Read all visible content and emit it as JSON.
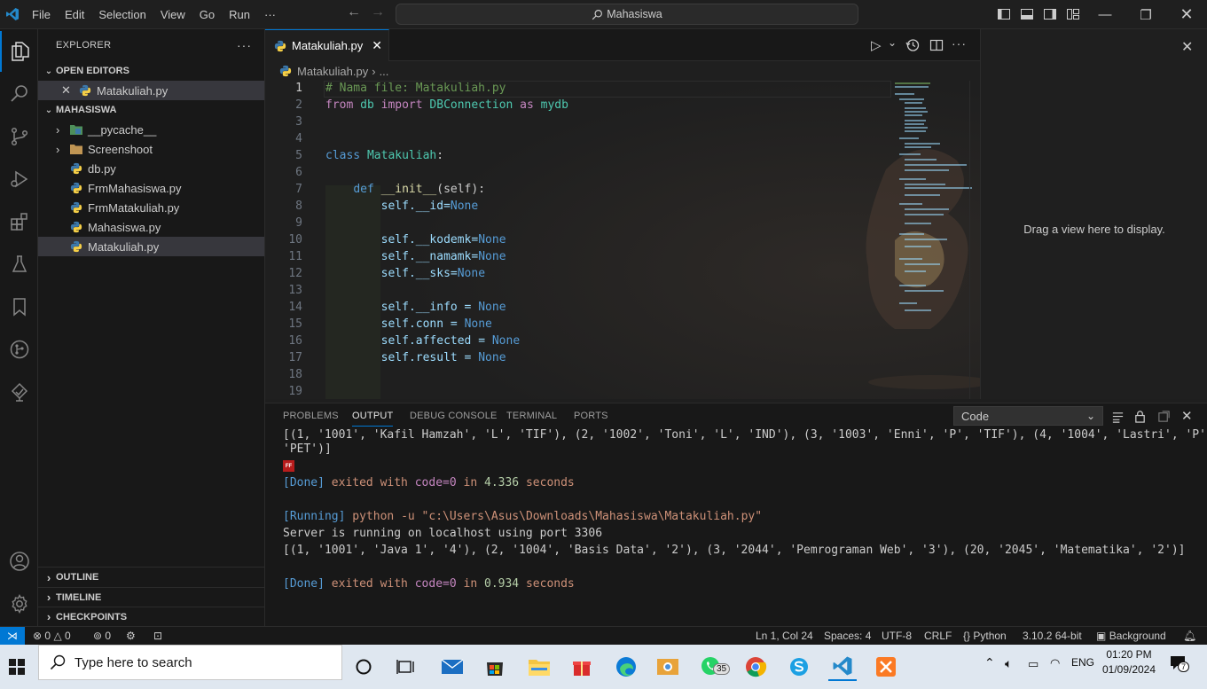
{
  "titlebar": {
    "menus": [
      "File",
      "Edit",
      "Selection",
      "View",
      "Go",
      "Run",
      "···"
    ],
    "search_text": "Mahasiswa"
  },
  "sidebar": {
    "title": "EXPLORER",
    "open_editors_label": "OPEN EDITORS",
    "open_editor_file": "Matakuliah.py",
    "project_label": "MAHASISWA",
    "items": [
      "__pycache__",
      "Screenshoot",
      "db.py",
      "FrmMahasiswa.py",
      "FrmMatakuliah.py",
      "Mahasiswa.py",
      "Matakuliah.py"
    ],
    "outline_label": "OUTLINE",
    "timeline_label": "TIMELINE",
    "checkpoints_label": "CHECKPOINTS"
  },
  "editor": {
    "tab_label": "Matakuliah.py",
    "breadcrumb_file": "Matakuliah.py",
    "breadcrumb_more": "...",
    "line_numbers": [
      "1",
      "2",
      "3",
      "4",
      "5",
      "6",
      "7",
      "8",
      "9",
      "10",
      "11",
      "12",
      "13",
      "14",
      "15",
      "16",
      "17",
      "18",
      "19"
    ],
    "comment_line": "# Nama file: Matakuliah.py",
    "code": {
      "from": "from",
      "db": "db",
      "import": "import",
      "DBConnection": "DBConnection",
      "as": "as",
      "mydb": "mydb",
      "class_kw": "class",
      "class_name": "Matakuliah",
      "colon": ":",
      "def_kw": "def",
      "init": "__init__",
      "init_args": "(self):",
      "self": "self",
      "none": "None",
      "l8": ".__id=",
      "l10": ".__kodemk=",
      "l11": ".__namamk=",
      "l12": ".__sks=",
      "l14": ".__info = ",
      "l15": ".conn = ",
      "l16": ".affected = ",
      "l17": ".result = "
    }
  },
  "rightpane": {
    "message": "Drag a view here to display."
  },
  "panel": {
    "tabs": [
      "PROBLEMS",
      "OUTPUT",
      "DEBUG CONSOLE",
      "TERMINAL",
      "PORTS"
    ],
    "dropdown_value": "Code",
    "lines": {
      "l0": "[(1, '1001', 'Kafil Hamzah', 'L', 'TIF'), (2, '1002', 'Toni', 'L', 'IND'), (3, '1003', 'Enni', 'P', 'TIF'), (4, '1004', 'Lastri', 'P',",
      "l1": "'PET')]",
      "ff": "FF",
      "done_tag": "[Done]",
      "done_text_1": " exited with ",
      "done_code": "code=0",
      "done_in": " in ",
      "done_time_1": "4.336",
      "done_seconds": " seconds",
      "running_tag": "[Running]",
      "running_cmd": " python -u \"c:\\Users\\Asus\\Downloads\\Mahasiswa\\Matakuliah.py\"",
      "server": "Server is running on localhost using port 3306",
      "result": "[(1, '1001', 'Java 1', '4'), (2, '1004', 'Basis Data', '2'), (3, '2044', 'Pemrograman Web', '3'), (20, '2045', 'Matematika', '2')]",
      "done_time_2": "0.934"
    }
  },
  "statusbar": {
    "errors": "0",
    "warnings": "0",
    "ports": "0",
    "position": "Ln 1, Col 24",
    "spaces": "Spaces: 4",
    "encoding": "UTF-8",
    "eol": "CRLF",
    "language": "Python",
    "version": "3.10.2 64-bit",
    "background": "Background"
  },
  "taskbar": {
    "search_placeholder": "Type here to search",
    "whatsapp_badge": "35",
    "lang": "ENG",
    "time": "01:20 PM",
    "date": "01/09/2024",
    "notif_count": "7"
  }
}
